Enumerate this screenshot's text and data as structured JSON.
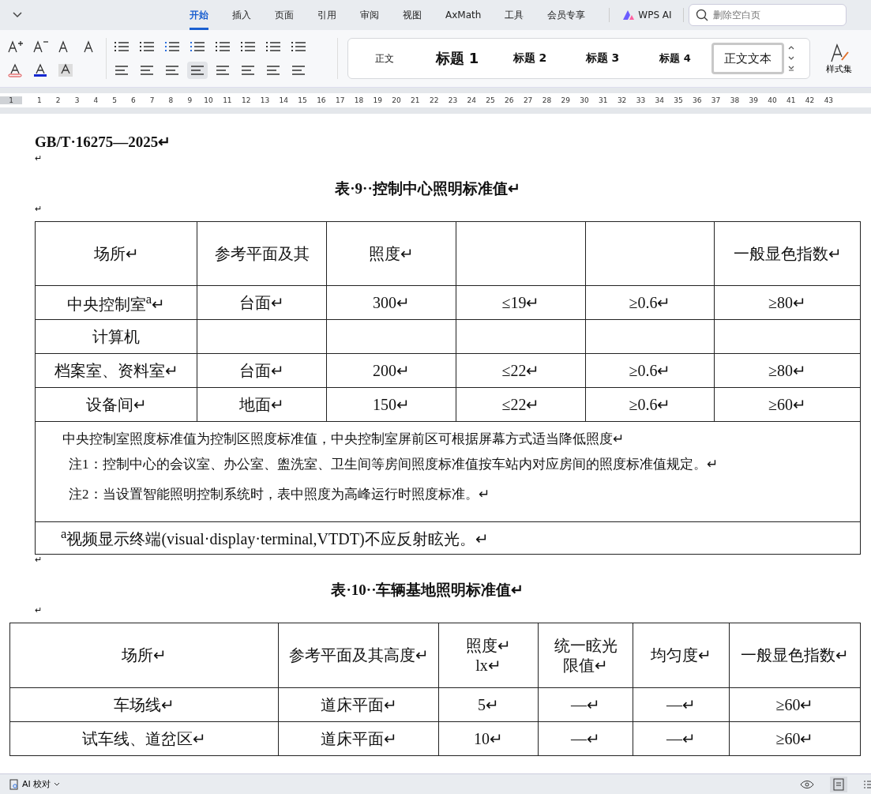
{
  "tabs": [
    {
      "label": "开始",
      "selected": true
    },
    {
      "label": "插入",
      "selected": false
    },
    {
      "label": "页面",
      "selected": false
    },
    {
      "label": "引用",
      "selected": false
    },
    {
      "label": "审阅",
      "selected": false
    },
    {
      "label": "视图",
      "selected": false
    },
    {
      "label": "AxMath",
      "selected": false
    },
    {
      "label": "工具",
      "selected": false
    },
    {
      "label": "会员专享",
      "selected": false
    }
  ],
  "ai_button": {
    "label": "WPS AI"
  },
  "search": {
    "placeholder": "删除空白页"
  },
  "styles": [
    {
      "label": "正文",
      "kind": "body",
      "selected": false
    },
    {
      "label": "标题 1",
      "kind": "h1",
      "selected": false
    },
    {
      "label": "标题 2",
      "kind": "h2",
      "selected": false
    },
    {
      "label": "标题 3",
      "kind": "h3",
      "selected": false
    },
    {
      "label": "标题 4",
      "kind": "h4",
      "selected": false
    },
    {
      "label": "正文文本",
      "kind": "bodytext",
      "selected": true
    }
  ],
  "style_set": {
    "label": "样式集"
  },
  "ruler": [
    "1",
    "1",
    "2",
    "3",
    "4",
    "5",
    "6",
    "7",
    "8",
    "9",
    "10",
    "11",
    "12",
    "13",
    "14",
    "15",
    "16",
    "17",
    "18",
    "19",
    "20",
    "21",
    "22",
    "23",
    "24",
    "25",
    "26",
    "27",
    "28",
    "29",
    "30",
    "31",
    "32",
    "33",
    "34",
    "35",
    "36",
    "37",
    "38",
    "39",
    "40",
    "41",
    "42",
    "43"
  ],
  "blocks": [
    {
      "kind": "heading",
      "text": "GB/T·16275—2025↵"
    },
    {
      "kind": "blank",
      "text": "↵"
    },
    {
      "kind": "caption",
      "text": "表·9··控制中心照明标准值↵"
    },
    {
      "kind": "blank",
      "text": "↵"
    },
    {
      "kind": "table",
      "header": {
        "column_1": [
          "场所↵"
        ],
        "column_2": [
          "参考平面及其"
        ],
        "column_3": [
          "照度↵"
        ],
        "column_6": [
          "一般显色指数↵"
        ]
      },
      "rows": [
        {
          "column_1": "中央控制室$^{a}$↵",
          "column_2": "台面↵",
          "column_3": "300↵",
          "column_4": "≤19↵",
          "column_5": "≥0.6↵",
          "column_6": "≥80↵"
        },
        {
          "column_1": "计算机"
        },
        {
          "column_1": "档案室、资料室↵",
          "column_2": "台面↵",
          "column_3": "200↵",
          "column_4": "≤22↵",
          "column_5": "≥0.6↵",
          "column_6": "≥80↵"
        },
        {
          "column_1": "设备间↵",
          "column_2": "地面↵",
          "column_3": "150↵",
          "column_4": "≤22↵",
          "column_5": "≥0.6↵",
          "column_6": "≥60↵"
        }
      ],
      "notes": [
        "中央控制室照度标准值为控制区照度标准值，中央控制室屏前区可根据屏幕方式适当降低照度↵",
        "注1：控制中心的会议室、办公室、盥洗室、卫生间等房间照度标准值按车站内对应房间的照度标准值规定。↵",
        "注2：当设置智能照明控制系统时，表中照度为高峰运行时照度标准。↵"
      ],
      "footnote": "$^{a}$视频显示终端(visual·display·terminal,VTDT)不应反射眩光。↵"
    },
    {
      "kind": "blank",
      "text": "↵"
    },
    {
      "kind": "caption",
      "text": "表·10··车辆基地照明标准值↵"
    },
    {
      "kind": "blank",
      "text": "↵"
    },
    {
      "kind": "table",
      "header": {
        "column_1": [
          "场所↵"
        ],
        "column_2": [
          "参考平面及其高度↵"
        ],
        "column_3": [
          "照度↵",
          "lx↵"
        ],
        "column_4": [
          "统一眩光",
          "限值↵"
        ],
        "column_5": [
          "均匀度↵"
        ],
        "column_6": [
          "一般显色指数↵"
        ]
      },
      "rows": [
        {
          "column_1": "车场线↵",
          "column_2": "道床平面↵",
          "column_3": "5↵",
          "column_4": "—↵",
          "column_5": "—↵",
          "column_6": "≥60↵"
        },
        {
          "column_1": "试车线、道岔区↵",
          "column_2": "道床平面↵",
          "column_3": "10↵",
          "column_4": "—↵",
          "column_5": "—↵",
          "column_6": "≥60↵"
        }
      ]
    }
  ],
  "status_bar": {
    "proofread": "AI 校对"
  }
}
